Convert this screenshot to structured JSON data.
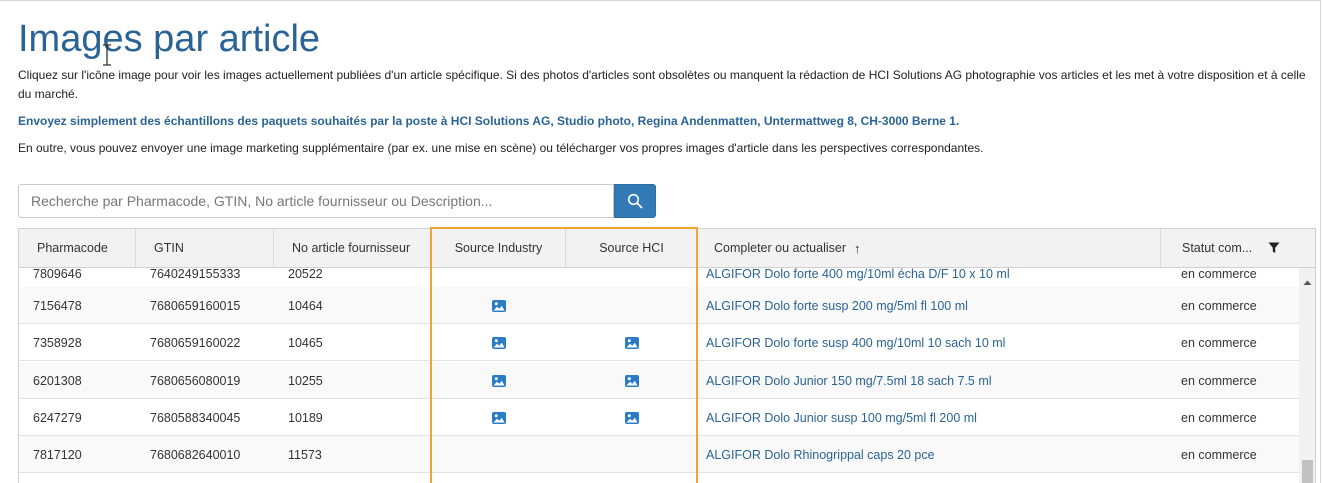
{
  "page": {
    "title": "Images par article",
    "intro": "Cliquez sur l'icône image pour voir les images actuellement publiées d'un article spécifique. Si des photos d'articles sont obsolètes ou manquent la rédaction de HCI Solutions AG photographie vos articles et les met à votre disposition et à celle du marché.",
    "send_samples": "Envoyez simplement des échantillons des paquets souhaités par la poste à HCI Solutions AG, Studio photo, Regina Andenmatten, Untermattweg 8, CH-3000 Berne 1.",
    "marketing": "En outre, vous pouvez envoyer une image marketing supplémentaire (par ex. une mise en scène) ou télécharger vos propres images d'article dans les perspectives correspondantes."
  },
  "search": {
    "placeholder": "Recherche par Pharmacode, GTIN, No article fournisseur ou Description...",
    "value": ""
  },
  "table": {
    "columns": {
      "pharmacode": "Pharmacode",
      "gtin": "GTIN",
      "supplier_no": "No article fournisseur",
      "source_industry": "Source Industry",
      "source_hci": "Source HCI",
      "description": "Completer ou actualiser",
      "status": "Statut com..."
    },
    "sort_arrow": "↑",
    "rows": [
      {
        "pharmacode": "7809646",
        "gtin": "7640249155333",
        "supplier_no": "20522",
        "industry_image": false,
        "hci_image": false,
        "description": "ALGIFOR Dolo forte 400 mg/10ml écha D/F 10 x 10 ml",
        "status": "en commerce"
      },
      {
        "pharmacode": "7156478",
        "gtin": "7680659160015",
        "supplier_no": "10464",
        "industry_image": true,
        "hci_image": false,
        "description": "ALGIFOR Dolo forte susp 200 mg/5ml fl 100 ml",
        "status": "en commerce"
      },
      {
        "pharmacode": "7358928",
        "gtin": "7680659160022",
        "supplier_no": "10465",
        "industry_image": true,
        "hci_image": true,
        "description": "ALGIFOR Dolo forte susp 400 mg/10ml 10 sach 10 ml",
        "status": "en commerce"
      },
      {
        "pharmacode": "6201308",
        "gtin": "7680656080019",
        "supplier_no": "10255",
        "industry_image": true,
        "hci_image": true,
        "description": "ALGIFOR Dolo Junior 150 mg/7.5ml 18 sach 7.5 ml",
        "status": "en commerce"
      },
      {
        "pharmacode": "6247279",
        "gtin": "7680588340045",
        "supplier_no": "10189",
        "industry_image": true,
        "hci_image": true,
        "description": "ALGIFOR Dolo Junior susp 100 mg/5ml fl 200 ml",
        "status": "en commerce"
      },
      {
        "pharmacode": "7817120",
        "gtin": "7680682640010",
        "supplier_no": "11573",
        "industry_image": false,
        "hci_image": false,
        "description": "ALGIFOR Dolo Rhinogrippal caps 20 pce",
        "status": "en commerce"
      }
    ]
  },
  "icons": {
    "search": "search-icon",
    "filter": "filter-icon",
    "image": "image-icon",
    "scroll_up": "scroll-up-icon"
  },
  "colors": {
    "title": "#2a6496",
    "link": "#2a6496",
    "search_button": "#337ab7",
    "highlight": "#f0a531",
    "header_bg": "#f2f2f2"
  }
}
